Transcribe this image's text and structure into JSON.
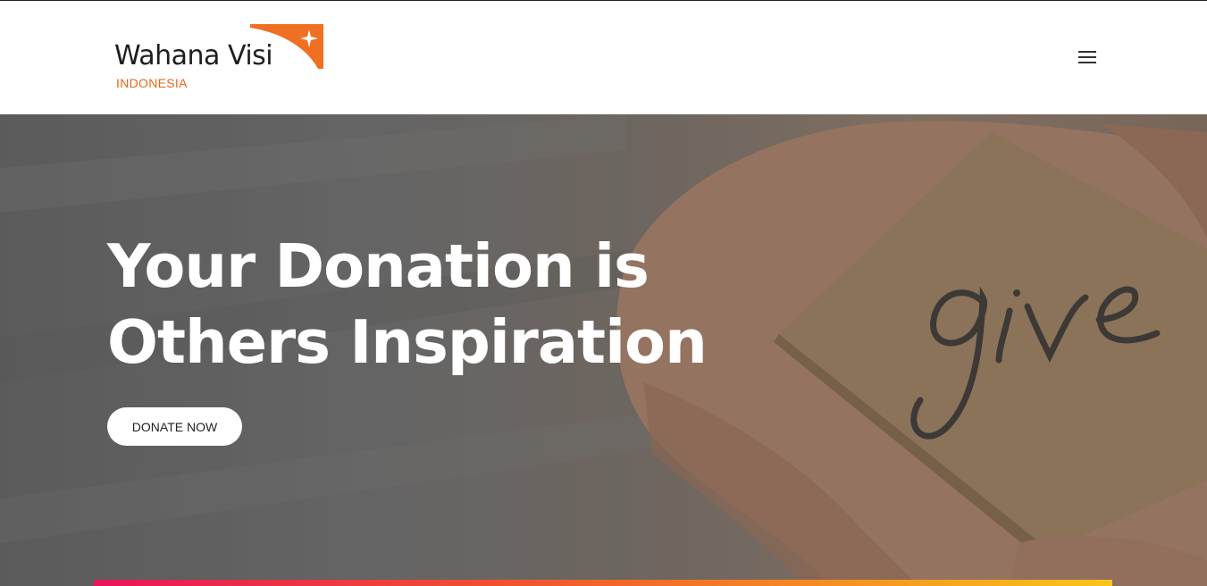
{
  "header": {
    "logo": {
      "name": "Wahana Visi",
      "subtitle": "INDONESIA",
      "brand_color": "#e8641b",
      "icon": "star-swoosh-logo"
    },
    "menu_icon": "hamburger-menu-icon"
  },
  "hero": {
    "title_line1": "Your Donation is",
    "title_line2": "Others Inspiration",
    "image_text": "give",
    "cta_label": "DONATE NOW",
    "accent_colors": [
      "#e8155a",
      "#f0512f",
      "#f58a22",
      "#f8c51c"
    ]
  }
}
